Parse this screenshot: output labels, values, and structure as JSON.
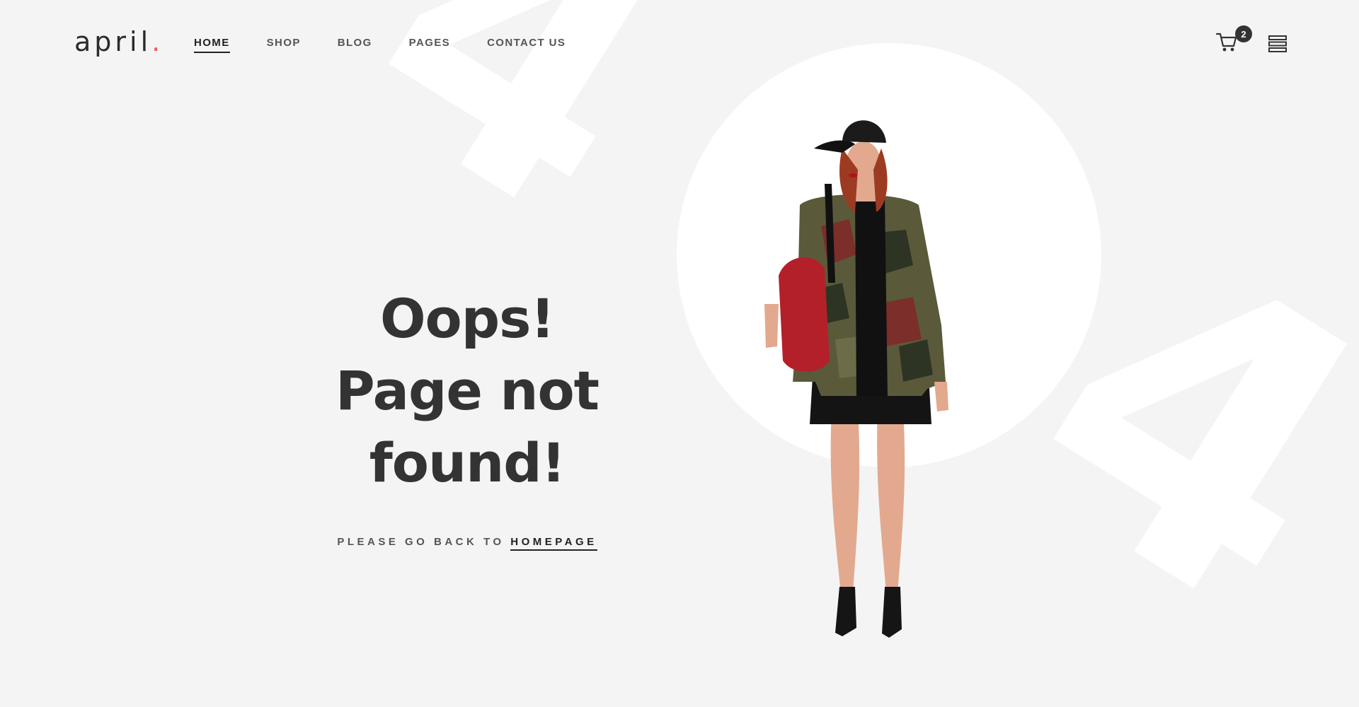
{
  "background_decor": {
    "digit_left": "4",
    "digit_right": "4"
  },
  "header": {
    "logo_text": "april",
    "logo_dot": ".",
    "nav": [
      {
        "label": "HOME",
        "active": true
      },
      {
        "label": "SHOP",
        "active": false
      },
      {
        "label": "BLOG",
        "active": false
      },
      {
        "label": "PAGES",
        "active": false
      },
      {
        "label": "CONTACT US",
        "active": false
      }
    ],
    "cart_icon": "shopping-cart-icon",
    "cart_count": "2",
    "menu_icon": "stacked-lines-menu-icon"
  },
  "hero": {
    "title_line1": "Oops!",
    "title_line2": "Page not found!",
    "back_prefix": "PLEASE GO BACK TO",
    "back_link": "HOMEPAGE"
  },
  "colors": {
    "background": "#f4f4f4",
    "accent_dot": "#f05a5a",
    "text_dark": "#333333"
  }
}
